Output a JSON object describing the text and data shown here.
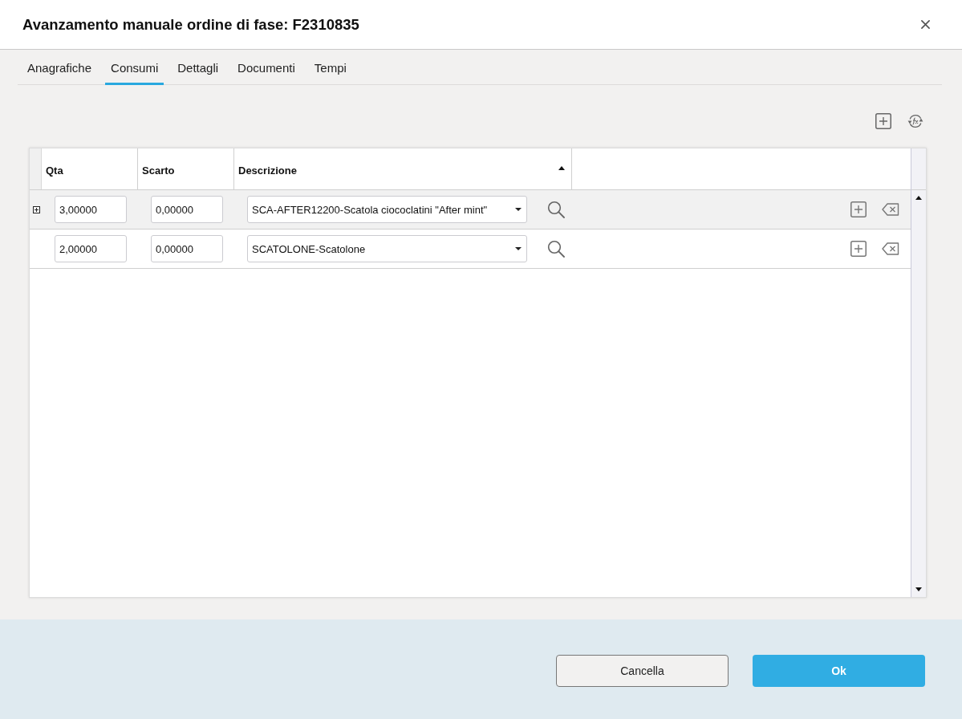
{
  "dialog": {
    "title": "Avanzamento manuale ordine di fase: F2310835"
  },
  "tabs": [
    {
      "label": "Anagrafiche",
      "selected": false
    },
    {
      "label": "Consumi",
      "selected": true
    },
    {
      "label": "Dettagli",
      "selected": false
    },
    {
      "label": "Documenti",
      "selected": false
    },
    {
      "label": "Tempi",
      "selected": false
    }
  ],
  "grid": {
    "columns": [
      {
        "label": "Qta",
        "sorted_ascending": false
      },
      {
        "label": "Scarto",
        "sorted_ascending": false
      },
      {
        "label": "Descrizione",
        "sorted_ascending": true
      }
    ],
    "rows": [
      {
        "selected": true,
        "expandable": true,
        "qta": "3,00000",
        "scarto": "0,00000",
        "descrizione": "SCA-AFTER12200-Scatola ciococlatini \"After mint\""
      },
      {
        "selected": false,
        "expandable": false,
        "qta": "2,00000",
        "scarto": "0,00000",
        "descrizione": "SCATOLONE-Scatolone"
      }
    ]
  },
  "buttons": [
    {
      "label": "Cancella",
      "kind": "secondary"
    },
    {
      "label": "Ok",
      "kind": "primary"
    }
  ]
}
